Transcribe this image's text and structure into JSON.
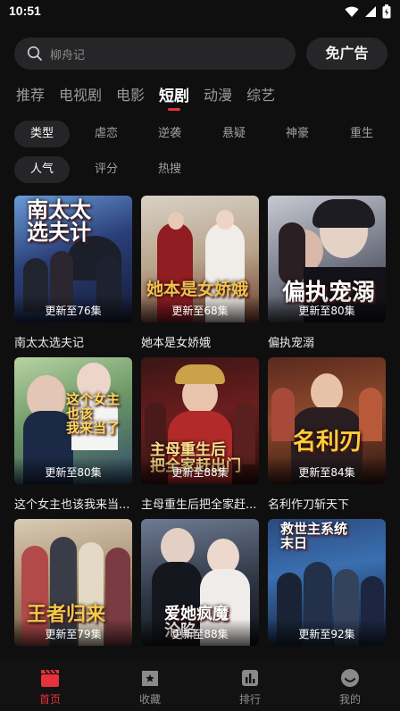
{
  "status_bar": {
    "time": "10:51"
  },
  "search": {
    "placeholder": "柳舟记"
  },
  "header": {
    "adfree_label": "免广告"
  },
  "main_tabs": [
    {
      "label": "推荐"
    },
    {
      "label": "电视剧"
    },
    {
      "label": "电影"
    },
    {
      "label": "短剧",
      "active": true
    },
    {
      "label": "动漫"
    },
    {
      "label": "综艺"
    }
  ],
  "filters_row1": [
    "类型",
    "虐恋",
    "逆袭",
    "悬疑",
    "神豪",
    "重生"
  ],
  "filters_row2": [
    "人气",
    "评分",
    "热搜"
  ],
  "cards": [
    {
      "title": "南太太选夫记",
      "badge": "更新至76集",
      "art": "南太太\n选夫计"
    },
    {
      "title": "她本是女娇娥",
      "badge": "更新至68集",
      "art": "她本是女娇娥"
    },
    {
      "title": "偏执宠溺",
      "badge": "更新至80集",
      "art": "偏执宠溺"
    },
    {
      "title": "这个女主也该我来当...",
      "badge": "更新至80集",
      "art": "这个女主也该\n我来当了"
    },
    {
      "title": "主母重生后把全家赶...",
      "badge": "更新至88集",
      "art": "主母重生后\n把全家赶出门"
    },
    {
      "title": "名利作刀斩天下",
      "badge": "更新至84集",
      "art": "名利刃"
    },
    {
      "title": "",
      "badge": "更新至79集",
      "art": "王者归来"
    },
    {
      "title": "",
      "badge": "更新至88集",
      "art": "爱她疯魔\n沦陷"
    },
    {
      "title": "",
      "badge": "更新至92集",
      "art": "救世主系统\n末日"
    }
  ],
  "bottom_nav": [
    {
      "label": "首页",
      "icon": "clapperboard-icon",
      "active": true
    },
    {
      "label": "收藏",
      "icon": "favorite-box-icon"
    },
    {
      "label": "排行",
      "icon": "ranking-icon"
    },
    {
      "label": "我的",
      "icon": "profile-smile-icon"
    }
  ],
  "colors": {
    "accent": "#e8313a",
    "background": "#0f0f10",
    "chip": "#252527"
  }
}
